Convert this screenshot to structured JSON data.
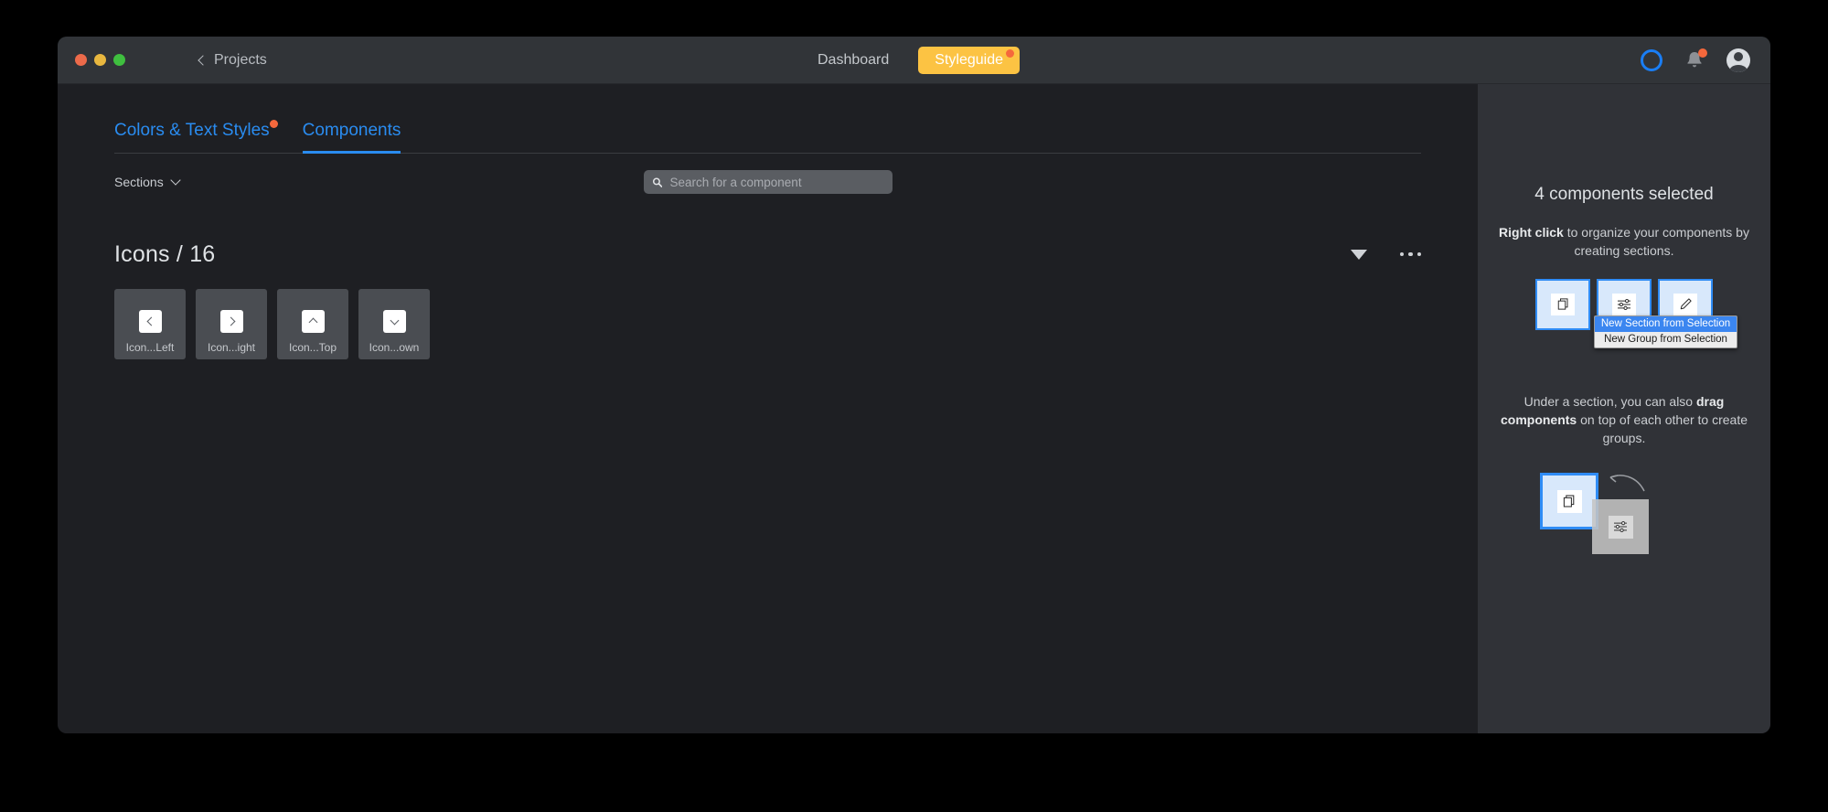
{
  "window": {
    "traffic_lights": [
      "close",
      "minimize",
      "zoom"
    ],
    "back_label": "Projects",
    "nav_tabs": [
      {
        "label": "Dashboard",
        "active": false
      },
      {
        "label": "Styleguide",
        "active": true,
        "has_badge": true
      }
    ],
    "right_icons": [
      "sync-ring-icon",
      "bell-icon",
      "avatar"
    ]
  },
  "tabs": [
    {
      "label": "Colors & Text Styles",
      "active": false,
      "has_dot": true
    },
    {
      "label": "Components",
      "active": true,
      "has_dot": false
    }
  ],
  "toolbar": {
    "sections_label": "Sections",
    "search_placeholder": "Search for a component",
    "search_value": ""
  },
  "section": {
    "title": "Icons / 16",
    "collapse_icon": "triangle-down-icon",
    "more_icon": "ellipsis-icon"
  },
  "components": [
    {
      "label": "Icon...Left",
      "glyph": "chevron-left-icon",
      "dir": "left"
    },
    {
      "label": "Icon...ight",
      "glyph": "chevron-right-icon",
      "dir": "right"
    },
    {
      "label": "Icon...Top",
      "glyph": "chevron-up-icon",
      "dir": "up"
    },
    {
      "label": "Icon...own",
      "glyph": "chevron-down-icon",
      "dir": "down"
    }
  ],
  "sidebar": {
    "title": "4 components selected",
    "tip1_bold": "Right click",
    "tip1_rest": " to organize your components by creating sections.",
    "context_menu": [
      {
        "label": "New Section from Selection",
        "selected": true
      },
      {
        "label": "New Group from Selection",
        "selected": false
      }
    ],
    "tip2_lead": "Under a section, you can also ",
    "tip2_bold": "drag components",
    "tip2_rest": " on top of each other to create groups.",
    "illus_icons": [
      "layers-icon",
      "sliders-icon",
      "pencil-icon"
    ]
  },
  "colors": {
    "accent_blue": "#2a8cf0",
    "highlight_yellow": "#fcc343",
    "notification_orange": "#f5683c",
    "window_bg": "#1e1f23",
    "titlebar_bg": "#313438",
    "sidebar_bg": "#303237",
    "card_bg": "#4a4d52"
  }
}
